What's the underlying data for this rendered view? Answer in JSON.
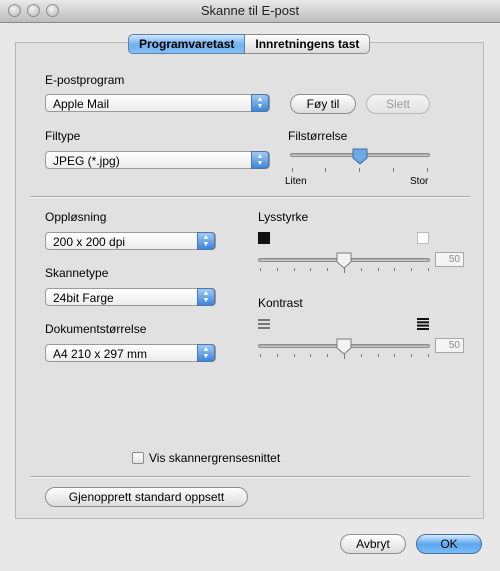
{
  "window": {
    "title": "Skanne til E-post"
  },
  "tabs": [
    {
      "label": "Programvaretast",
      "selected": true
    },
    {
      "label": "Innretningens tast",
      "selected": false
    }
  ],
  "email_program": {
    "label": "E-postprogram",
    "value": "Apple Mail",
    "add_label": "Føy til",
    "delete_label": "Slett"
  },
  "file_type": {
    "label": "Filtype",
    "value": "JPEG (*.jpg)"
  },
  "file_size": {
    "label": "Filstørrelse",
    "min_label": "Liten",
    "max_label": "Stor",
    "level": 0.5
  },
  "resolution": {
    "label": "Oppløsning",
    "value": "200 x 200 dpi"
  },
  "scan_type": {
    "label": "Skannetype",
    "value": "24bit Farge"
  },
  "document_size": {
    "label": "Dokumentstørrelse",
    "value": "A4  210 x 297 mm"
  },
  "brightness": {
    "label": "Lysstyrke",
    "value": "50",
    "level": 0.5
  },
  "contrast": {
    "label": "Kontrast",
    "value": "50",
    "level": 0.5
  },
  "show_scanner_interface": {
    "label": "Vis skannergrensesnittet",
    "checked": false
  },
  "restore_defaults_label": "Gjenopprett standard oppsett",
  "cancel_label": "Avbryt",
  "ok_label": "OK",
  "colors": {
    "accent": "#3d86d9",
    "default_button": "#5ba8f0"
  }
}
